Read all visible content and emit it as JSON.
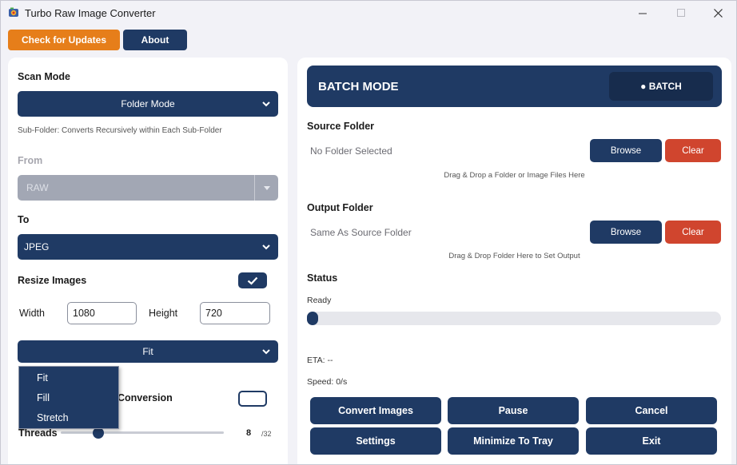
{
  "window": {
    "title": "Turbo Raw Image Converter"
  },
  "topbar": {
    "check_updates": "Check for Updates",
    "about": "About"
  },
  "left": {
    "scan_mode_label": "Scan Mode",
    "scan_mode_value": "Folder Mode",
    "scan_mode_hint": "Sub-Folder: Converts Recursively within Each Sub-Folder",
    "from_label": "From",
    "from_value": "RAW",
    "to_label": "To",
    "to_value": "JPEG",
    "resize_label": "Resize Images",
    "resize_checked": true,
    "width_label": "Width",
    "width_value": "1080",
    "height_label": "Height",
    "height_value": "720",
    "fit_value": "Fit",
    "fit_options": [
      "Fit",
      "Fill",
      "Stretch"
    ],
    "conversion_label": "Conversion",
    "conversion_checked": false,
    "threads_label": "Threads",
    "threads_value": "8",
    "threads_max": "/32",
    "threads_fraction": 0.25
  },
  "right": {
    "mode_title": "BATCH MODE",
    "mode_badge": "● BATCH",
    "source_title": "Source Folder",
    "source_value": "No Folder Selected",
    "source_hint": "Drag & Drop a Folder or Image Files Here",
    "output_title": "Output Folder",
    "output_value": "Same As Source Folder",
    "output_hint": "Drag & Drop Folder Here to Set Output",
    "browse": "Browse",
    "clear": "Clear",
    "status_title": "Status",
    "status_value": "Ready",
    "progress_fraction": 0.0,
    "eta": "ETA: --",
    "speed": "Speed: 0/s"
  },
  "actions": {
    "convert": "Convert Images",
    "pause": "Pause",
    "cancel": "Cancel",
    "settings": "Settings",
    "minimize": "Minimize To Tray",
    "exit": "Exit"
  },
  "colors": {
    "primary": "#1f3a64",
    "accent_orange": "#e67e1a",
    "danger": "#d0452e"
  }
}
